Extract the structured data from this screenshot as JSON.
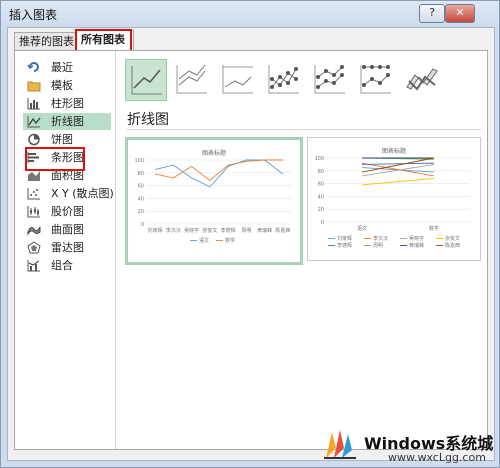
{
  "window": {
    "title": "插入图表",
    "help_label": "?",
    "close_label": "✕"
  },
  "tabs": [
    {
      "label": "推荐的图表"
    },
    {
      "label": "所有图表"
    }
  ],
  "sidebar": {
    "items": [
      {
        "label": "最近",
        "icon": "recent-icon"
      },
      {
        "label": "模板",
        "icon": "folder-icon"
      },
      {
        "label": "柱形图",
        "icon": "column-chart-icon"
      },
      {
        "label": "折线图",
        "icon": "line-chart-icon"
      },
      {
        "label": "饼图",
        "icon": "pie-chart-icon"
      },
      {
        "label": "条形图",
        "icon": "bar-chart-icon"
      },
      {
        "label": "面积图",
        "icon": "area-chart-icon"
      },
      {
        "label": "X Y (散点图)",
        "icon": "scatter-chart-icon"
      },
      {
        "label": "股价图",
        "icon": "stock-chart-icon"
      },
      {
        "label": "曲面图",
        "icon": "surface-chart-icon"
      },
      {
        "label": "雷达图",
        "icon": "radar-chart-icon"
      },
      {
        "label": "组合",
        "icon": "combo-chart-icon"
      }
    ],
    "selected": "折线图"
  },
  "subtypes": [
    {
      "icon": "line-icon"
    },
    {
      "icon": "stacked-line-icon"
    },
    {
      "icon": "percent-stacked-line-icon"
    },
    {
      "icon": "line-with-markers-icon"
    },
    {
      "icon": "stacked-line-with-markers-icon"
    },
    {
      "icon": "percent-stacked-line-with-markers-icon"
    },
    {
      "icon": "3d-line-icon"
    }
  ],
  "heading": "折线图",
  "preview1": {
    "title": "图表标题",
    "y_ticks": [
      "100",
      "80",
      "60",
      "40",
      "20",
      "0"
    ],
    "categories": [
      "刘家辉",
      "李沉沉",
      "吴晓宇",
      "张俊文",
      "李德辉",
      "周明",
      "黄瑞峰",
      "陈嘉西"
    ],
    "legend": [
      "语文",
      "数学"
    ],
    "colors": [
      "#5b9bd5",
      "#ed7d31"
    ]
  },
  "preview2": {
    "title": "图表标题",
    "y_ticks": [
      "100",
      "80",
      "60",
      "40",
      "20",
      "0"
    ],
    "categories": [
      "语文",
      "数学"
    ],
    "legend": [
      "刘家辉",
      "李沉沉",
      "吴晓宇",
      "张俊文",
      "李德辉",
      "周明",
      "黄瑞峰",
      "陈嘉西"
    ]
  },
  "chart_data": [
    {
      "type": "line",
      "title": "图表标题",
      "categories": [
        "刘家辉",
        "李沉沉",
        "吴晓宇",
        "张俊文",
        "李德辉",
        "周明",
        "黄瑞峰",
        "陈嘉西"
      ],
      "ylim": [
        0,
        100
      ],
      "series": [
        {
          "name": "语文",
          "values": [
            85,
            92,
            72,
            58,
            90,
            100,
            100,
            78
          ]
        },
        {
          "name": "数学",
          "values": [
            78,
            72,
            90,
            68,
            92,
            98,
            100,
            100
          ]
        }
      ]
    },
    {
      "type": "line",
      "title": "图表标题",
      "categories": [
        "语文",
        "数学"
      ],
      "ylim": [
        0,
        100
      ],
      "series": [
        {
          "name": "刘家辉",
          "values": [
            85,
            78
          ]
        },
        {
          "name": "李沉沉",
          "values": [
            92,
            72
          ]
        },
        {
          "name": "吴晓宇",
          "values": [
            72,
            90
          ]
        },
        {
          "name": "张俊文",
          "values": [
            58,
            68
          ]
        },
        {
          "name": "李德辉",
          "values": [
            90,
            92
          ]
        },
        {
          "name": "周明",
          "values": [
            100,
            98
          ]
        },
        {
          "name": "黄瑞峰",
          "values": [
            100,
            100
          ]
        },
        {
          "name": "陈嘉西",
          "values": [
            78,
            100
          ]
        }
      ]
    }
  ],
  "watermark": {
    "brand": "Windows系统城",
    "url": "www.wxcLgg.com"
  }
}
